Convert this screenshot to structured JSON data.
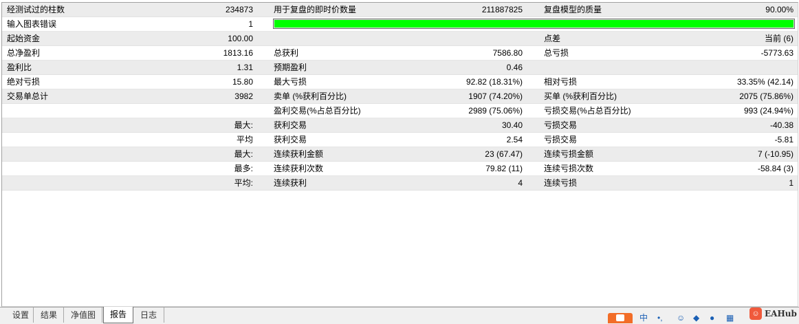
{
  "report": {
    "rows": [
      {
        "cells": [
          "经测试过的柱数",
          "234873",
          "用于复盘的即时价数量",
          "211887825",
          "复盘模型的质量",
          "90.00%"
        ]
      },
      {
        "cells": [
          "输入图表错误",
          "1",
          "",
          "",
          "",
          ""
        ],
        "quality_bar": {
          "fill_fraction": 1.0,
          "color": "#00ff00"
        }
      },
      {
        "cells": [
          "起始资金",
          "100.00",
          "",
          "",
          "点差",
          "当前 (6)"
        ]
      },
      {
        "cells": [
          "总净盈利",
          "1813.16",
          "总获利",
          "7586.80",
          "总亏损",
          "-5773.63"
        ]
      },
      {
        "cells": [
          "盈利比",
          "1.31",
          "预期盈利",
          "0.46",
          "",
          ""
        ]
      },
      {
        "cells": [
          "绝对亏损",
          "15.80",
          "最大亏损",
          "92.82 (18.31%)",
          "相对亏损",
          "33.35% (42.14)"
        ]
      },
      {
        "cells": [
          "交易单总计",
          "3982",
          "卖单 (%获利百分比)",
          "1907 (74.20%)",
          "买单 (%获利百分比)",
          "2075 (75.86%)"
        ]
      },
      {
        "cells": [
          "",
          "",
          "盈利交易(%占总百分比)",
          "2989 (75.06%)",
          "亏损交易(%占总百分比)",
          "993 (24.94%)"
        ]
      },
      {
        "cells": [
          "",
          "最大:",
          "获利交易",
          "30.40",
          "亏损交易",
          "-40.38"
        ]
      },
      {
        "cells": [
          "",
          "平均",
          "获利交易",
          "2.54",
          "亏损交易",
          "-5.81"
        ]
      },
      {
        "cells": [
          "",
          "最大:",
          "连续获利金额",
          "23 (67.47)",
          "连续亏损金额",
          "7 (-10.95)"
        ]
      },
      {
        "cells": [
          "",
          "最多:",
          "连续获利次数",
          "79.82 (11)",
          "连续亏损次数",
          "-58.84 (3)"
        ]
      },
      {
        "cells": [
          "",
          "平均:",
          "连续获利",
          "4",
          "连续亏损",
          "1"
        ]
      }
    ]
  },
  "tabs": [
    {
      "label": "设置",
      "active": false
    },
    {
      "label": "结果",
      "active": false
    },
    {
      "label": "净值图",
      "active": false
    },
    {
      "label": "报告",
      "active": true
    },
    {
      "label": "日志",
      "active": false
    }
  ],
  "tray": {
    "icons": [
      "sogou-input-icon",
      "chinese-mode-icon",
      "punctuation-icon",
      "emoji-icon",
      "settings-icon",
      "mic-icon",
      "keyboard-icon"
    ],
    "chinese_mode_label": "中"
  },
  "watermark": {
    "text": "EAHub",
    "logo_glyph": "☺"
  }
}
